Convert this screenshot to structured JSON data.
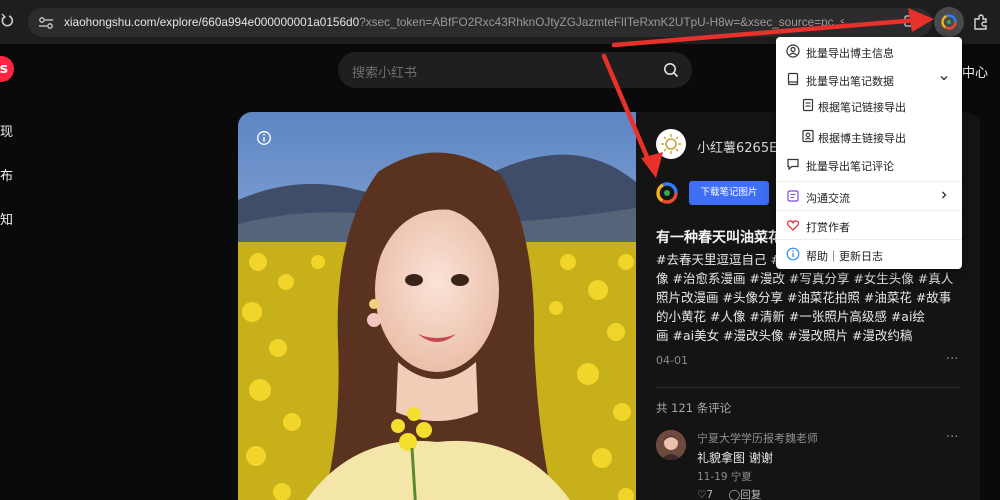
{
  "browser": {
    "url_main": "xiaohongshu.com/explore/660a994e000000001a0156d0",
    "url_rest": "?xsec_token=ABfFO2Rxc43RhknOJtyZGJazmteFlITeRxnK2UTpU-H8w=&xsec_source=pc_search",
    "icons": {
      "reload": "reload-icon",
      "site_info": "site-settings-icon",
      "install": "install-app-icon",
      "extension": "extension-logo-icon",
      "extensions_menu": "puzzle-icon"
    }
  },
  "app": {
    "logo_text": "s",
    "nav_items": [
      "现",
      "布",
      "知"
    ],
    "search_placeholder": "搜索小红书",
    "header_right": "中心",
    "brand_color": "#ff2442"
  },
  "note": {
    "author": "小红薯6265E3",
    "download_button": "下载笔记图片",
    "title": "有一种春天叫油菜花",
    "tag_lines": [
      "#去春天里逗逗自己 #",
      "像 #治愈系漫画 #漫改 #写真分享 #女生头像 #真人",
      "照片改漫画 #头像分享 #油菜花拍照 #油菜花 #故事",
      "的小黄花 #人像 #清新 #一张照片高级感 #ai绘",
      "画 #ai美女 #漫改头像 #漫改照片 #漫改约稿"
    ],
    "date": "04-01",
    "more_glyph": "···",
    "comment_count": "共 121 条评论",
    "comment": {
      "user": "宁夏大学学历报考魏老师",
      "text": "礼貌拿图 谢谢",
      "meta": "11-19 宁夏",
      "likes": "7",
      "reply": "回复"
    },
    "accent_color": "#3e6ff5"
  },
  "popup_menu": {
    "items": [
      {
        "label": "批量导出博主信息",
        "icon": "user-circle-icon"
      },
      {
        "label": "批量导出笔记数据",
        "icon": "book-icon",
        "expanded": true
      },
      {
        "label": "根据笔记链接导出",
        "icon": "document-icon",
        "sub": true
      },
      {
        "label": "根据博主链接导出",
        "icon": "user-card-icon",
        "sub": true
      },
      {
        "label": "批量导出笔记评论",
        "icon": "comment-icon"
      },
      {
        "label": "沟通交流",
        "icon": "chat-icon",
        "has_submenu": true
      },
      {
        "label": "打赏作者",
        "icon": "heart-icon"
      },
      {
        "label": "帮助｜更新日志",
        "icon": "info-icon"
      }
    ]
  },
  "annotation_color": "#e8312a"
}
